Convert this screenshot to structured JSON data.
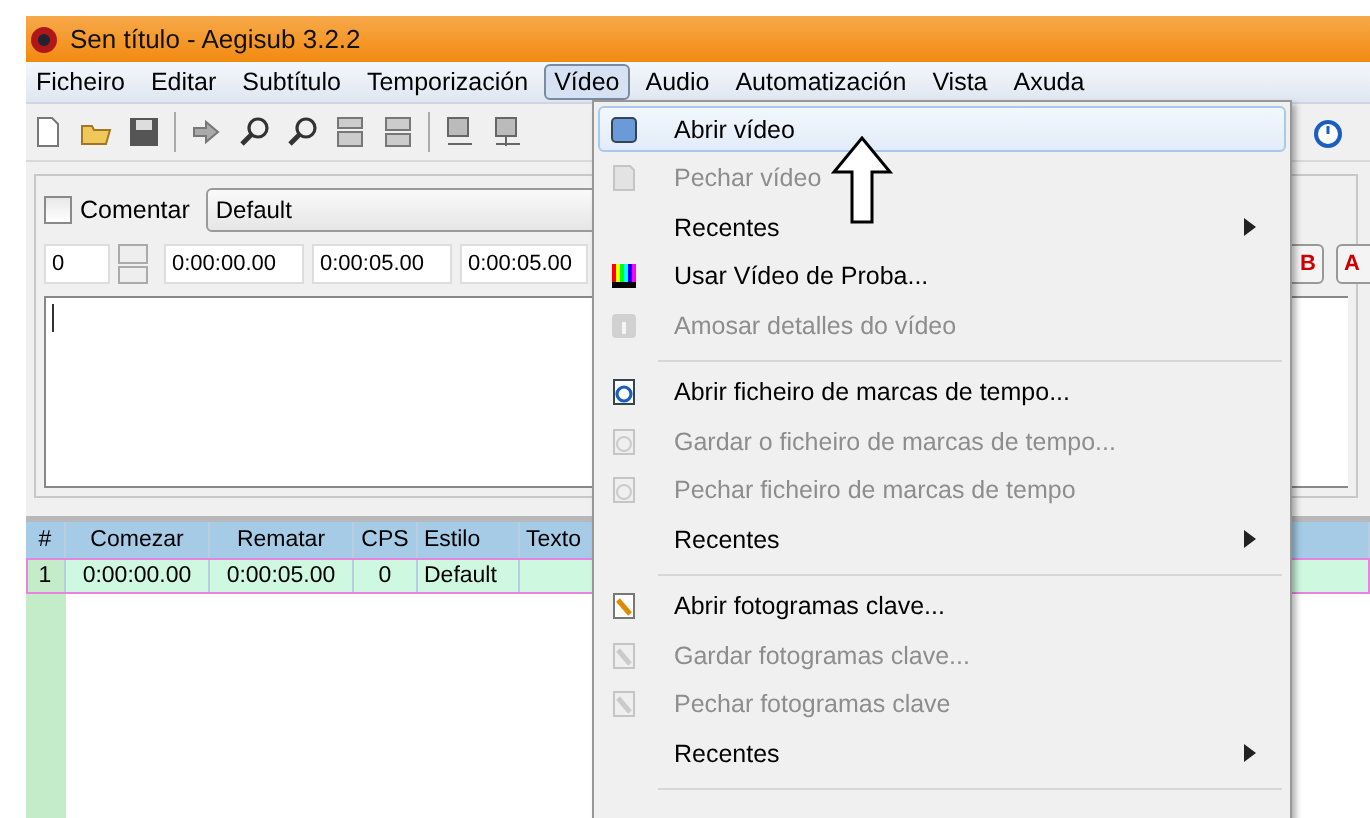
{
  "window": {
    "title": "Sen título - Aegisub 3.2.2"
  },
  "menu_bar": [
    {
      "label": "Ficheiro",
      "selected": false
    },
    {
      "label": "Editar",
      "selected": false
    },
    {
      "label": "Subtítulo",
      "selected": false
    },
    {
      "label": "Temporización",
      "selected": false
    },
    {
      "label": "Vídeo",
      "selected": true
    },
    {
      "label": "Audio",
      "selected": false
    },
    {
      "label": "Automatización",
      "selected": false
    },
    {
      "label": "Vista",
      "selected": false
    },
    {
      "label": "Axuda",
      "selected": false
    }
  ],
  "editor": {
    "comment": {
      "label": "Comentar",
      "checked": false
    },
    "style": "Default",
    "layer": "0",
    "start": "0:00:00.00",
    "end": "0:00:05.00",
    "duration": "0:00:05.00",
    "format_buttons": [
      "B",
      "A"
    ]
  },
  "grid": {
    "columns": [
      "#",
      "Comezar",
      "Rematar",
      "CPS",
      "Estilo",
      "Texto"
    ],
    "rows": [
      {
        "cells": [
          "1",
          "0:00:00.00",
          "0:00:05.00",
          "0",
          "Default"
        ],
        "selected": true
      }
    ]
  },
  "dropdown": [
    {
      "kind": "item",
      "label": "Abrir vídeo",
      "disabled": false,
      "submenu": false,
      "selected": true
    },
    {
      "kind": "item",
      "label": "Pechar vídeo",
      "disabled": true,
      "submenu": false,
      "selected": false
    },
    {
      "kind": "item",
      "label": "Recentes",
      "disabled": false,
      "submenu": true,
      "selected": false
    },
    {
      "kind": "item",
      "label": "Usar Vídeo de Proba...",
      "disabled": false,
      "submenu": false,
      "selected": false
    },
    {
      "kind": "item",
      "label": "Amosar detalles do vídeo",
      "disabled": true,
      "submenu": false,
      "selected": false
    },
    {
      "kind": "separator"
    },
    {
      "kind": "item",
      "label": "Abrir ficheiro de marcas de tempo...",
      "disabled": false,
      "submenu": false,
      "selected": false
    },
    {
      "kind": "item",
      "label": "Gardar o ficheiro de marcas de tempo...",
      "disabled": true,
      "submenu": false,
      "selected": false
    },
    {
      "kind": "item",
      "label": "Pechar ficheiro de marcas de tempo",
      "disabled": true,
      "submenu": false,
      "selected": false
    },
    {
      "kind": "item",
      "label": "Recentes",
      "disabled": false,
      "submenu": true,
      "selected": false
    },
    {
      "kind": "separator"
    },
    {
      "kind": "item",
      "label": "Abrir fotogramas clave...",
      "disabled": false,
      "submenu": false,
      "selected": false
    },
    {
      "kind": "item",
      "label": "Gardar fotogramas clave...",
      "disabled": true,
      "submenu": false,
      "selected": false
    },
    {
      "kind": "item",
      "label": "Pechar fotogramas clave",
      "disabled": true,
      "submenu": false,
      "selected": false
    },
    {
      "kind": "item",
      "label": "Recentes",
      "disabled": false,
      "submenu": true,
      "selected": false
    },
    {
      "kind": "separator"
    }
  ]
}
